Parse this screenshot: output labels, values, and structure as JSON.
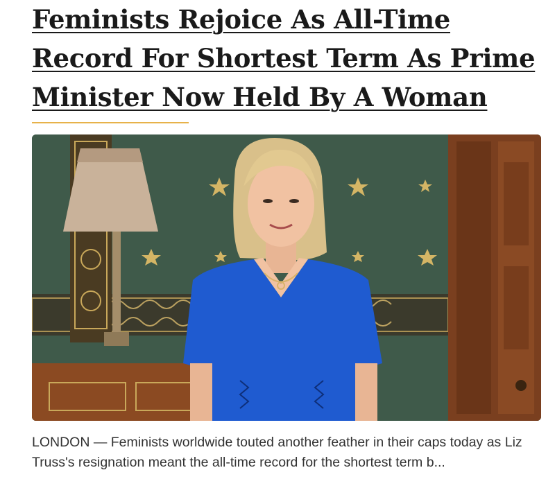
{
  "article": {
    "headline": "Feminists Rejoice As All-Time Record For Shortest Term As Prime Minister Now Held By A Woman",
    "excerpt": "LONDON — Feminists worldwide touted another feather in their caps today as Liz Truss's resignation meant the all-time record for the shortest term b...",
    "accent_color": "#e7b24a"
  },
  "hero_image": {
    "icon": "portrait-photo",
    "colors": {
      "wall": "#3f5a4a",
      "wood": "#7a3f1f",
      "dress": "#1f5bd0",
      "hair": "#d9c08a"
    }
  }
}
